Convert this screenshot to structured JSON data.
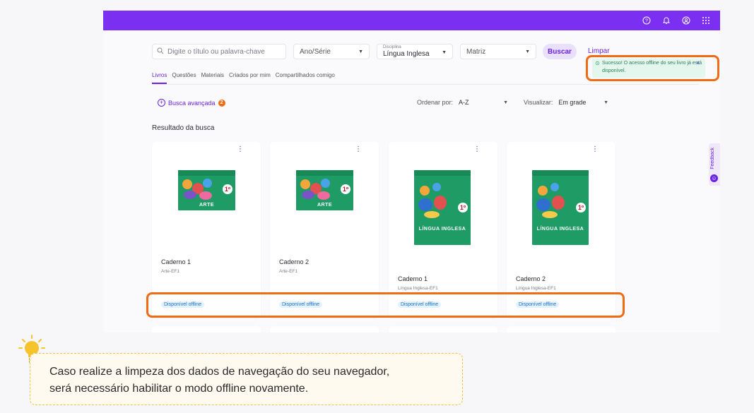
{
  "topbar": {
    "icons": [
      "help-circle-icon",
      "bell-icon",
      "user-circle-icon",
      "apps-grid-icon"
    ]
  },
  "filters": {
    "search_placeholder": "Digite o título ou palavra-chave",
    "ano_serie": "Ano/Série",
    "disciplina_label": "Disciplina",
    "disciplina_value": "Língua Inglesa",
    "matriz": "Matriz",
    "buscar": "Buscar",
    "limpar": "Limpar"
  },
  "tabs": [
    "Livros",
    "Questões",
    "Materiais",
    "Criados por mim",
    "Compartilhados comigo"
  ],
  "advanced": {
    "label": "Busca avançada",
    "count": "2"
  },
  "sort": {
    "label": "Ordenar por:",
    "value": "A-Z"
  },
  "view": {
    "label": "Visualizar:",
    "value": "Em grade"
  },
  "results_title": "Resultado da busca",
  "cards": [
    {
      "title": "Caderno 1",
      "subtitle": "Arte-EF1",
      "cover_word": "ARTE",
      "grade": "1º",
      "status": "Disponível offline"
    },
    {
      "title": "Caderno 2",
      "subtitle": "Arte-EF1",
      "cover_word": "ARTE",
      "grade": "1º",
      "status": "Disponível offline"
    },
    {
      "title": "Caderno 1",
      "subtitle": "Língua Inglesa-EF1",
      "cover_word": "LÍNGUA INGLESA",
      "grade": "1º",
      "status": "Disponível offline"
    },
    {
      "title": "Caderno 2",
      "subtitle": "Língua Inglesa-EF1",
      "cover_word": "LÍNGUA INGLESA",
      "grade": "1º",
      "status": "Disponível offline"
    }
  ],
  "toast": {
    "message": "Sucesso! O acesso offline do seu livro já está disponível.",
    "close": "×"
  },
  "feedback": "Feedback",
  "tip": {
    "line1": "Caso realize a limpeza dos dados de navegação do seu navegador,",
    "line2": "será necessário habilitar o modo offline novamente."
  },
  "colors": {
    "brand": "#7b2ff0",
    "accent": "#6a22e4",
    "highlight": "#ef6b14",
    "cover_green": "#1f9b66"
  }
}
